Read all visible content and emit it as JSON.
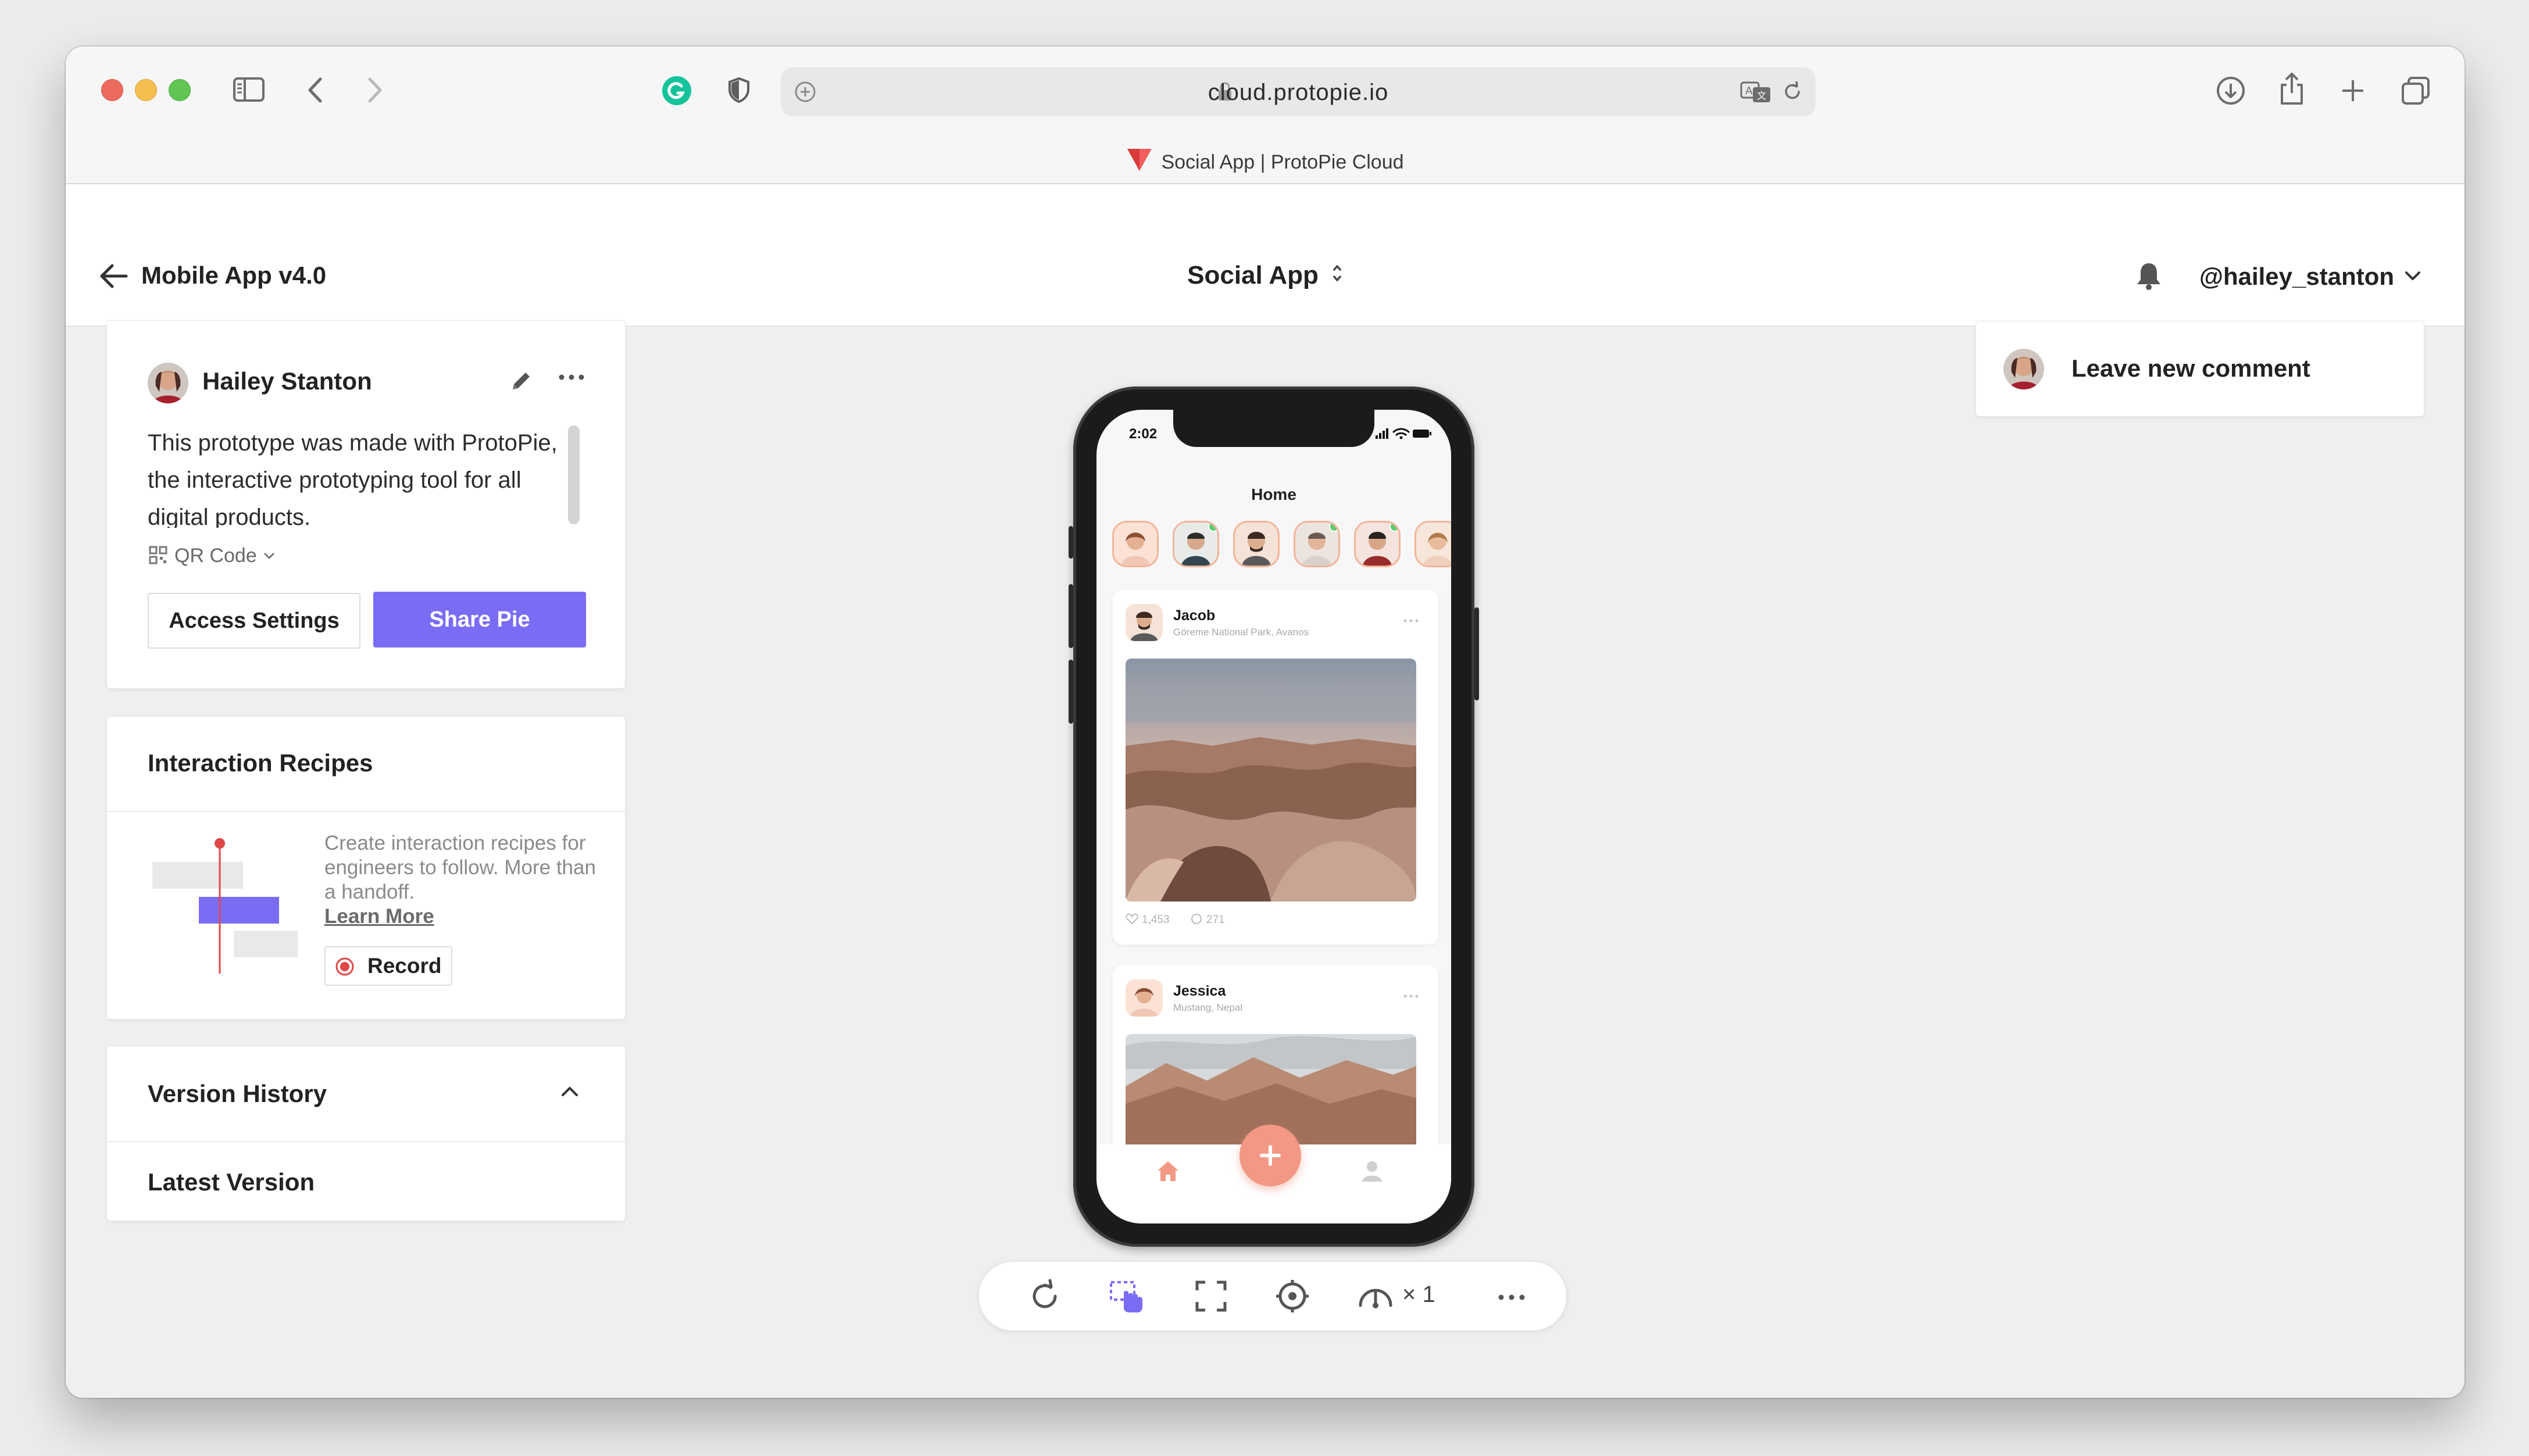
{
  "browser": {
    "url": "cloud.protopie.io",
    "tab_title": "Social App | ProtoPie Cloud"
  },
  "header": {
    "project_title": "Mobile App v4.0",
    "center_title": "Social App",
    "username": "@hailey_stanton"
  },
  "info_panel": {
    "author": "Hailey Stanton",
    "description": "This prototype was made with ProtoPie, the interactive prototyping tool for all digital products.",
    "qr_label": "QR Code",
    "access_settings_label": "Access Settings",
    "share_label": "Share Pie"
  },
  "recipes_panel": {
    "title": "Interaction Recipes",
    "text": "Create interaction recipes for engineers to follow. More than a handoff.",
    "learn_more": "Learn More",
    "record_label": "Record"
  },
  "version_panel": {
    "title": "Version History",
    "latest": "Latest Version"
  },
  "comment": {
    "label": "Leave new comment"
  },
  "phone": {
    "time": "2:02",
    "screen_title": "Home",
    "posts": [
      {
        "name": "Jacob",
        "location": "Göreme National Park, Avanos",
        "likes": "1,453",
        "comments": "271"
      },
      {
        "name": "Jessica",
        "location": "Mustang, Nepal"
      }
    ]
  },
  "toolbar": {
    "speed": "× 1"
  },
  "colors": {
    "accent": "#7b6cf6",
    "fab": "#f29885",
    "record_red": "#e04848"
  }
}
